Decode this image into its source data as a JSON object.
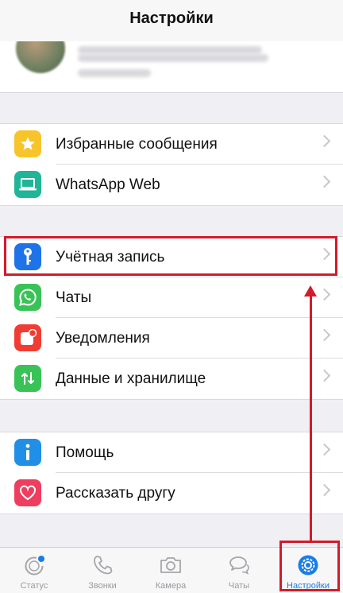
{
  "header": {
    "title": "Настройки"
  },
  "groups": [
    {
      "items": [
        {
          "label": "Избранные сообщения",
          "icon": "star-icon",
          "color": "#f7c52b"
        },
        {
          "label": "WhatsApp Web",
          "icon": "laptop-icon",
          "color": "#1fb598"
        }
      ]
    },
    {
      "items": [
        {
          "label": "Учётная запись",
          "icon": "key-icon",
          "color": "#1f73e8"
        },
        {
          "label": "Чаты",
          "icon": "whatsapp-icon",
          "color": "#39c357"
        },
        {
          "label": "Уведомления",
          "icon": "notification-icon",
          "color": "#ef3d33"
        },
        {
          "label": "Данные и хранилище",
          "icon": "data-transfer-icon",
          "color": "#39c357"
        }
      ]
    },
    {
      "items": [
        {
          "label": "Помощь",
          "icon": "info-icon",
          "color": "#1f8fe8"
        },
        {
          "label": "Рассказать другу",
          "icon": "heart-icon",
          "color": "#ef3d5f"
        }
      ]
    }
  ],
  "tabs": [
    {
      "label": "Статус",
      "icon": "status-icon"
    },
    {
      "label": "Звонки",
      "icon": "phone-icon"
    },
    {
      "label": "Камера",
      "icon": "camera-icon"
    },
    {
      "label": "Чаты",
      "icon": "chats-icon"
    },
    {
      "label": "Настройки",
      "icon": "settings-icon",
      "active": true
    }
  ],
  "colors": {
    "accent": "#1a7de6",
    "annotation": "#d21b2a"
  }
}
